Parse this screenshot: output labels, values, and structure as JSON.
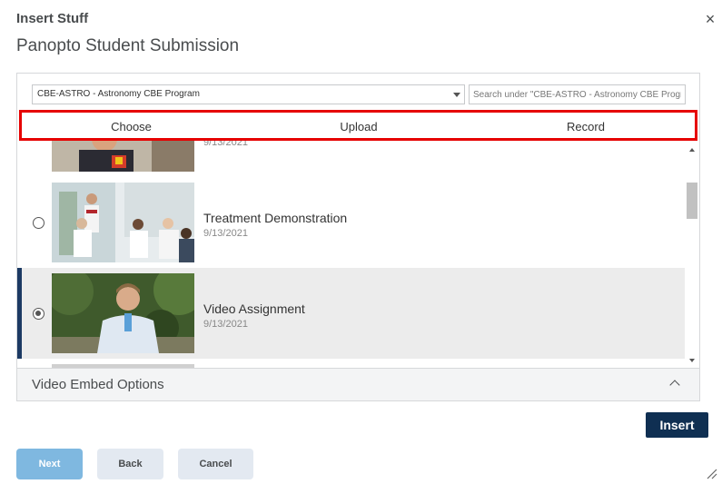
{
  "dialog": {
    "title": "Insert Stuff",
    "close_label": "×",
    "page_title": "Panopto Student Submission"
  },
  "toolbar": {
    "folder_value": "CBE-ASTRO - Astronomy CBE Program",
    "search_placeholder": "Search under \"CBE-ASTRO - Astronomy CBE Program\""
  },
  "tabs": [
    {
      "label": "Choose"
    },
    {
      "label": "Upload"
    },
    {
      "label": "Record"
    }
  ],
  "sessions": [
    {
      "title": "",
      "date": "9/13/2021",
      "selected": false
    },
    {
      "title": "Treatment Demonstration",
      "date": "9/13/2021",
      "selected": false
    },
    {
      "title": "Video Assignment",
      "date": "9/13/2021",
      "selected": true
    }
  ],
  "embed_options": {
    "label": "Video Embed Options"
  },
  "buttons": {
    "insert": "Insert",
    "next": "Next",
    "back": "Back",
    "cancel": "Cancel"
  },
  "colors": {
    "highlight": "#e60000",
    "primary": "#0f2f52",
    "next_button": "#7fb8e0",
    "selection_bar": "#1c3a63"
  },
  "icons": {
    "close": "close-icon",
    "dropdown": "chevron-down-icon",
    "collapse": "chevron-up-icon",
    "resize": "resize-grip-icon"
  }
}
